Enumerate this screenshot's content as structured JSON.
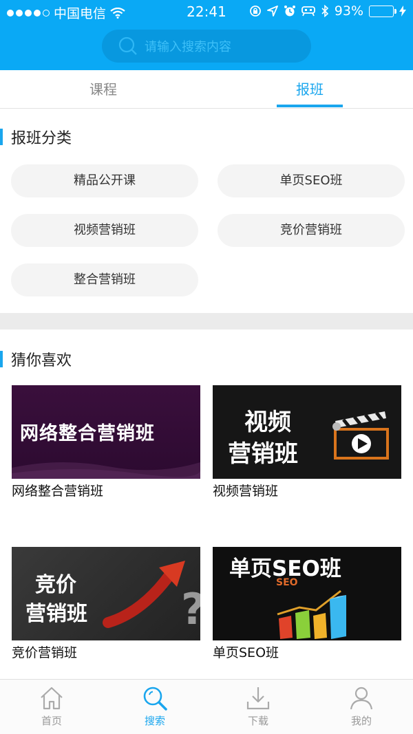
{
  "status_bar": {
    "carrier": "中国电信",
    "time": "22:41",
    "battery": "93%",
    "battery_level": 0.93
  },
  "search": {
    "placeholder": "请输入搜索内容"
  },
  "tabs": [
    {
      "label": "课程",
      "active": false
    },
    {
      "label": "报班",
      "active": true
    }
  ],
  "categories_section": {
    "title": "报班分类",
    "items": [
      "精品公开课",
      "单页SEO班",
      "视频营销班",
      "竞价营销班",
      "整合营销班"
    ]
  },
  "recommend_section": {
    "title": "猜你喜欢",
    "cards": [
      {
        "caption": "网络整合营销班",
        "banner_text": [
          "网络整合营销班"
        ]
      },
      {
        "caption": "视频营销班",
        "banner_text": [
          "视频",
          "营销班"
        ]
      },
      {
        "caption": "竞价营销班",
        "banner_text": [
          "竞价",
          "营销班"
        ]
      },
      {
        "caption": "单页SEO班",
        "banner_text": [
          "单页SEO班",
          "SEO"
        ]
      }
    ]
  },
  "tab_bar": [
    {
      "label": "首页",
      "icon": "home-icon",
      "active": false
    },
    {
      "label": "搜索",
      "icon": "search-icon",
      "active": true
    },
    {
      "label": "下载",
      "icon": "download-icon",
      "active": false
    },
    {
      "label": "我的",
      "icon": "user-icon",
      "active": false
    }
  ],
  "colors": {
    "brand": "#0aa9f5",
    "accent": "#1aa6ee",
    "chip_bg": "#f4f4f4",
    "band": "#ebebeb"
  }
}
